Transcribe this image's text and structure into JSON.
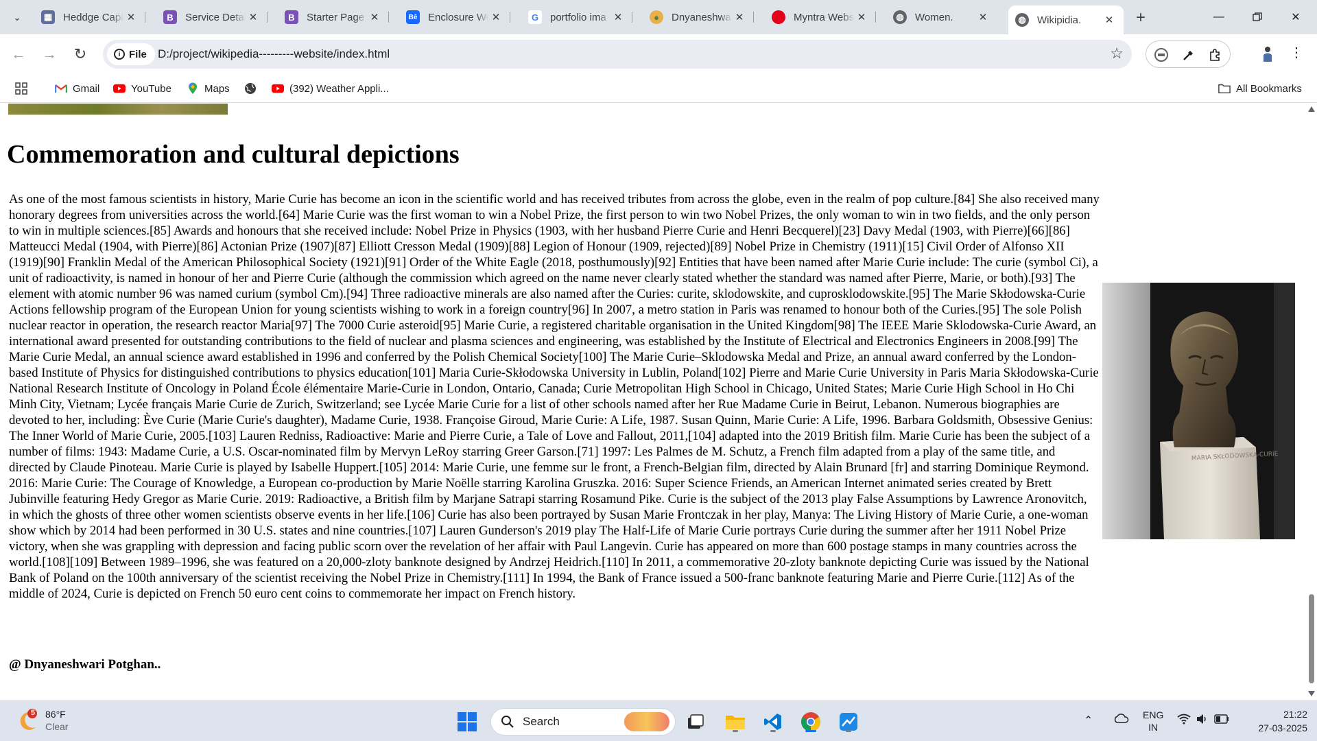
{
  "browser": {
    "tabs": [
      {
        "title": "Heddge Capi",
        "favicon": "heddge-favicon",
        "color": "#5f6e9b",
        "glyph": "▦"
      },
      {
        "title": "Service Detai",
        "favicon": "bootstrap-favicon",
        "color": "#7952b3",
        "glyph": "B"
      },
      {
        "title": "Starter Page",
        "favicon": "bootstrap-favicon",
        "color": "#7952b3",
        "glyph": "B"
      },
      {
        "title": "Enclosure We",
        "favicon": "behance-favicon",
        "color": "#1769ff",
        "glyph": "Bē"
      },
      {
        "title": "portfolio ima",
        "favicon": "google-favicon",
        "color": "#ffffff",
        "glyph": "G"
      },
      {
        "title": "Dnyaneshwar",
        "favicon": "profile-favicon",
        "color": "#e8b04a",
        "glyph": "●"
      },
      {
        "title": "Myntra Webs",
        "favicon": "myntra-favicon",
        "color": "#e4001b",
        "glyph": "●"
      },
      {
        "title": "Women.",
        "favicon": "globe-favicon",
        "color": "#5f6368",
        "glyph": "◍"
      },
      {
        "title": "Wikipidia.",
        "favicon": "globe-favicon",
        "color": "#5f6368",
        "glyph": "◍"
      }
    ],
    "address": {
      "scheme_label": "File",
      "url": "D:/project/wikipedia---------website/index.html"
    },
    "bookmarks": [
      {
        "label": "Gmail",
        "icon": "gmail-icon"
      },
      {
        "label": "YouTube",
        "icon": "youtube-icon"
      },
      {
        "label": "Maps",
        "icon": "maps-icon"
      },
      {
        "label": "",
        "icon": "globe-icon"
      },
      {
        "label": "(392) Weather Appli...",
        "icon": "youtube-icon"
      }
    ],
    "all_bookmarks_label": "All Bookmarks"
  },
  "page": {
    "heading": "Commemoration and cultural depictions",
    "article": "As one of the most famous scientists in history, Marie Curie has become an icon in the scientific world and has received tributes from across the globe, even in the realm of pop culture.[84] She also received many honorary degrees from universities across the world.[64] Marie Curie was the first woman to win a Nobel Prize, the first person to win two Nobel Prizes, the only woman to win in two fields, and the only person to win in multiple sciences.[85] Awards and honours that she received include: Nobel Prize in Physics (1903, with her husband Pierre Curie and Henri Becquerel)[23] Davy Medal (1903, with Pierre)[66][86] Matteucci Medal (1904, with Pierre)[86] Actonian Prize (1907)[87] Elliott Cresson Medal (1909)[88] Legion of Honour (1909, rejected)[89] Nobel Prize in Chemistry (1911)[15] Civil Order of Alfonso XII (1919)[90] Franklin Medal of the American Philosophical Society (1921)[91] Order of the White Eagle (2018, posthumously)[92] Entities that have been named after Marie Curie include: The curie (symbol Ci), a unit of radioactivity, is named in honour of her and Pierre Curie (although the commission which agreed on the name never clearly stated whether the standard was named after Pierre, Marie, or both).[93] The element with atomic number 96 was named curium (symbol Cm).[94] Three radioactive minerals are also named after the Curies: curite, sklodowskite, and cuprosklodowskite.[95] The Marie Skłodowska-Curie Actions fellowship program of the European Union for young scientists wishing to work in a foreign country[96] In 2007, a metro station in Paris was renamed to honour both of the Curies.[95] The sole Polish nuclear reactor in operation, the research reactor Maria[97] The 7000 Curie asteroid[95] Marie Curie, a registered charitable organisation in the United Kingdom[98] The IEEE Marie Sklodowska-Curie Award, an international award presented for outstanding contributions to the field of nuclear and plasma sciences and engineering, was established by the Institute of Electrical and Electronics Engineers in 2008.[99] The Marie Curie Medal, an annual science award established in 1996 and conferred by the Polish Chemical Society[100] The Marie Curie–Sklodowska Medal and Prize, an annual award conferred by the London-based Institute of Physics for distinguished contributions to physics education[101] Maria Curie-Skłodowska University in Lublin, Poland[102] Pierre and Marie Curie University in Paris Maria Skłodowska-Curie National Research Institute of Oncology in Poland École élémentaire Marie-Curie in London, Ontario, Canada; Curie Metropolitan High School in Chicago, United States; Marie Curie High School in Ho Chi Minh City, Vietnam; Lycée français Marie Curie de Zurich, Switzerland; see Lycée Marie Curie for a list of other schools named after her Rue Madame Curie in Beirut, Lebanon. Numerous biographies are devoted to her, including: Ève Curie (Marie Curie's daughter), Madame Curie, 1938. Françoise Giroud, Marie Curie: A Life, 1987. Susan Quinn, Marie Curie: A Life, 1996. Barbara Goldsmith, Obsessive Genius: The Inner World of Marie Curie, 2005.[103] Lauren Redniss, Radioactive: Marie and Pierre Curie, a Tale of Love and Fallout, 2011,[104] adapted into the 2019 British film. Marie Curie has been the subject of a number of films: 1943: Madame Curie, a U.S. Oscar-nominated film by Mervyn LeRoy starring Greer Garson.[71] 1997: Les Palmes de M. Schutz, a French film adapted from a play of the same title, and directed by Claude Pinoteau. Marie Curie is played by Isabelle Huppert.[105] 2014: Marie Curie, une femme sur le front, a French-Belgian film, directed by Alain Brunard [fr] and starring Dominique Reymond. 2016: Marie Curie: The Courage of Knowledge, a European co-production by Marie Noëlle starring Karolina Gruszka. 2016: Super Science Friends, an American Internet animated series created by Brett Jubinville featuring Hedy Gregor as Marie Curie. 2019: Radioactive, a British film by Marjane Satrapi starring Rosamund Pike. Curie is the subject of the 2013 play False Assumptions by Lawrence Aronovitch, in which the ghosts of three other women scientists observe events in her life.[106] Curie has also been portrayed by Susan Marie Frontczak in her play, Manya: The Living History of Marie Curie, a one-woman show which by 2014 had been performed in 30 U.S. states and nine countries.[107] Lauren Gunderson's 2019 play The Half-Life of Marie Curie portrays Curie during the summer after her 1911 Nobel Prize victory, when she was grappling with depression and facing public scorn over the revelation of her affair with Paul Langevin. Curie has appeared on more than 600 postage stamps in many countries across the world.[108][109] Between 1989–1996, she was featured on a 20,000-zloty banknote designed by Andrzej Heidrich.[110] In 2011, a commemorative 20-zloty banknote depicting Curie was issued by the National Bank of Poland on the 100th anniversary of the scientist receiving the Nobel Prize in Chemistry.[111] In 1994, the Bank of France issued a 500-franc banknote featuring Marie and Pierre Curie.[112] As of the middle of 2024, Curie is depicted on French 50 euro cent coins to commemorate her impact on French history.",
    "signature": "@ Dnyaneshwari Potghan..",
    "bust_plaque": "MARIA SKŁODOWSKA-CURIE"
  },
  "taskbar": {
    "weather": {
      "temp": "86°F",
      "condition": "Clear",
      "badge": "5"
    },
    "search_placeholder": "Search",
    "apps": [
      "start-icon",
      "search-icon",
      "widget-icon",
      "task-view-icon",
      "file-explorer-icon",
      "vscode-icon",
      "chrome-icon",
      "app-icon"
    ],
    "language": {
      "lang": "ENG",
      "region": "IN"
    },
    "clock": {
      "time": "21:22",
      "date": "27-03-2025"
    }
  }
}
